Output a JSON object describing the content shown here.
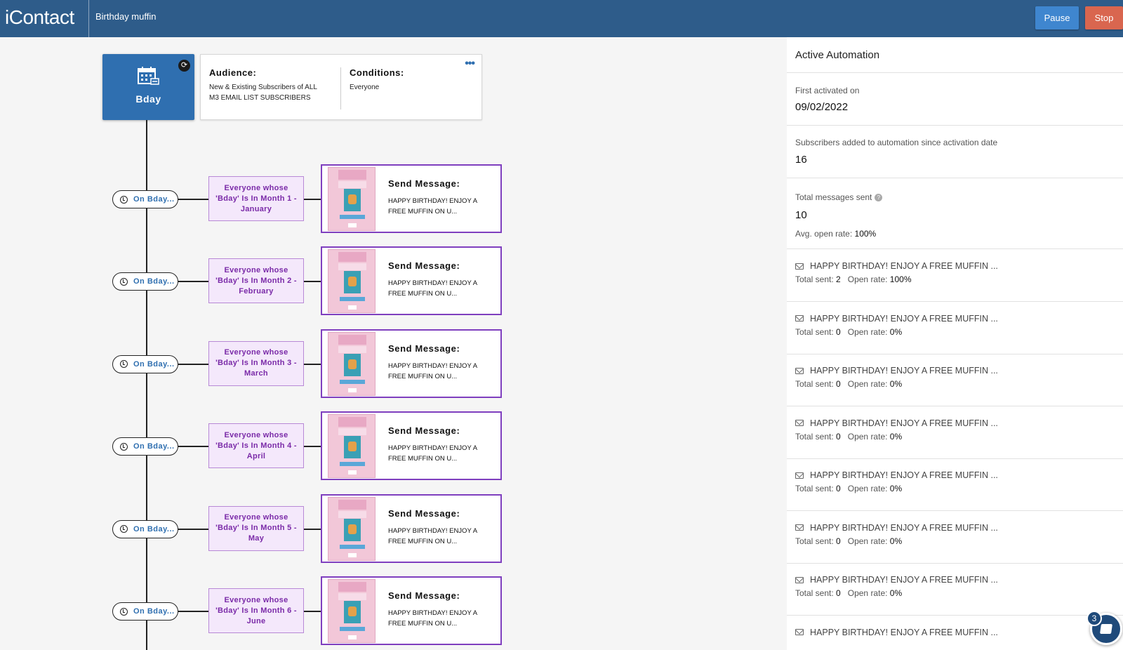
{
  "header": {
    "logo": "iContact",
    "title": "Birthday muffin",
    "pause_label": "Pause",
    "stop_label": "Stop"
  },
  "trigger": {
    "label": "Bday"
  },
  "info": {
    "audience_title": "Audience:",
    "audience_text": "New & Existing Subscribers of ALL M3 EMAIL LIST SUBSCRIBERS",
    "conditions_title": "Conditions:",
    "conditions_text": "Everyone",
    "menu": "•••"
  },
  "steps": [
    {
      "delay": "On Bday...",
      "condition": "Everyone whose 'Bday' Is In Month 1 - January",
      "msg_title": "Send Message:",
      "msg_text": "HAPPY BIRTHDAY! ENJOY A FREE MUFFIN ON U..."
    },
    {
      "delay": "On Bday...",
      "condition": "Everyone whose 'Bday' Is In Month 2 - February",
      "msg_title": "Send Message:",
      "msg_text": "HAPPY BIRTHDAY! ENJOY A FREE MUFFIN ON U..."
    },
    {
      "delay": "On Bday...",
      "condition": "Everyone whose 'Bday' Is In Month 3 - March",
      "msg_title": "Send Message:",
      "msg_text": "HAPPY BIRTHDAY! ENJOY A FREE MUFFIN ON U..."
    },
    {
      "delay": "On Bday...",
      "condition": "Everyone whose 'Bday' Is In Month 4 - April",
      "msg_title": "Send Message:",
      "msg_text": "HAPPY BIRTHDAY! ENJOY A FREE MUFFIN ON U..."
    },
    {
      "delay": "On Bday...",
      "condition": "Everyone whose 'Bday' Is In Month 5 - May",
      "msg_title": "Send Message:",
      "msg_text": "HAPPY BIRTHDAY! ENJOY A FREE MUFFIN ON U..."
    },
    {
      "delay": "On Bday...",
      "condition": "Everyone whose 'Bday' Is In Month 6 - June",
      "msg_title": "Send Message:",
      "msg_text": "HAPPY BIRTHDAY! ENJOY A FREE MUFFIN ON U..."
    }
  ],
  "sidebar": {
    "title": "Active Automation",
    "first_activated_label": "First activated on",
    "first_activated_value": "09/02/2022",
    "subscribers_label": "Subscribers added to automation since activation date",
    "subscribers_value": "16",
    "total_sent_label": "Total messages sent",
    "total_sent_value": "10",
    "avg_open_label": "Avg. open rate:",
    "avg_open_value": "100%",
    "messages": [
      {
        "subject": "HAPPY BIRTHDAY! ENJOY A FREE MUFFIN ...",
        "sent_label": "Total sent:",
        "sent": "2",
        "rate_label": "Open rate:",
        "rate": "100%"
      },
      {
        "subject": "HAPPY BIRTHDAY! ENJOY A FREE MUFFIN ...",
        "sent_label": "Total sent:",
        "sent": "0",
        "rate_label": "Open rate:",
        "rate": "0%"
      },
      {
        "subject": "HAPPY BIRTHDAY! ENJOY A FREE MUFFIN ...",
        "sent_label": "Total sent:",
        "sent": "0",
        "rate_label": "Open rate:",
        "rate": "0%"
      },
      {
        "subject": "HAPPY BIRTHDAY! ENJOY A FREE MUFFIN ...",
        "sent_label": "Total sent:",
        "sent": "0",
        "rate_label": "Open rate:",
        "rate": "0%"
      },
      {
        "subject": "HAPPY BIRTHDAY! ENJOY A FREE MUFFIN ...",
        "sent_label": "Total sent:",
        "sent": "0",
        "rate_label": "Open rate:",
        "rate": "0%"
      },
      {
        "subject": "HAPPY BIRTHDAY! ENJOY A FREE MUFFIN ...",
        "sent_label": "Total sent:",
        "sent": "0",
        "rate_label": "Open rate:",
        "rate": "0%"
      },
      {
        "subject": "HAPPY BIRTHDAY! ENJOY A FREE MUFFIN ...",
        "sent_label": "Total sent:",
        "sent": "0",
        "rate_label": "Open rate:",
        "rate": "0%"
      },
      {
        "subject": "HAPPY BIRTHDAY! ENJOY A FREE MUFFIN ...",
        "sent_label": "Total sent:",
        "sent": "",
        "rate_label": "",
        "rate": ""
      }
    ]
  },
  "chat": {
    "badge": "3"
  },
  "colors": {
    "header": "#2e5c8a",
    "pause": "#3f86cf",
    "stop": "#d9664f",
    "trigger": "#2f6fb0",
    "condition_text": "#7a2aa8",
    "message_border": "#7f3fbf"
  }
}
